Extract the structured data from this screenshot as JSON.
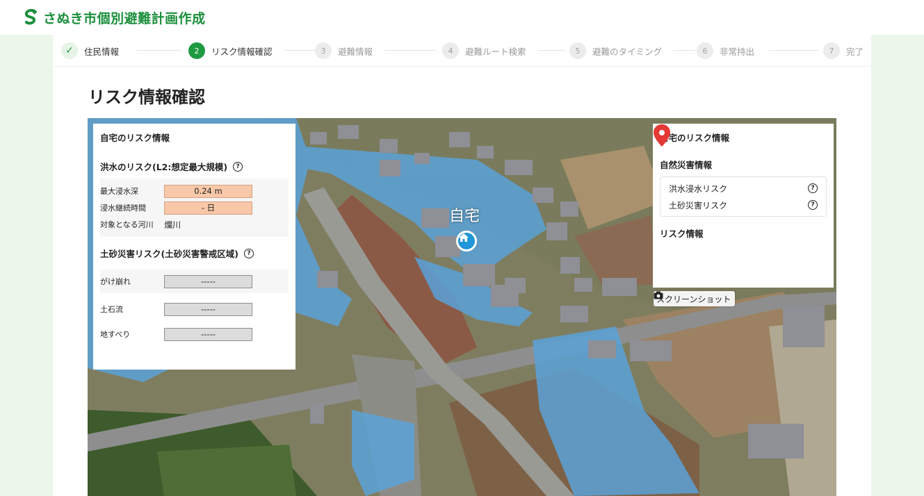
{
  "app": {
    "title": "さぬき市個別避難計画作成"
  },
  "steps": [
    {
      "num": "✓",
      "label": "住民情報",
      "state": "done"
    },
    {
      "num": "2",
      "label": "リスク情報確認",
      "state": "active"
    },
    {
      "num": "3",
      "label": "避難情報",
      "state": "pending"
    },
    {
      "num": "4",
      "label": "避難ルート検索",
      "state": "pending"
    },
    {
      "num": "5",
      "label": "避難のタイミング",
      "state": "pending"
    },
    {
      "num": "6",
      "label": "非常持出",
      "state": "pending"
    },
    {
      "num": "7",
      "label": "完了",
      "state": "pending"
    }
  ],
  "page": {
    "title": "リスク情報確認"
  },
  "map": {
    "home_label": "自宅"
  },
  "left_panel": {
    "title": "自宅のリスク情報",
    "flood": {
      "heading": "洪水のリスク(L2:想定最大規模)",
      "help": "?",
      "rows": [
        {
          "label": "最大浸水深",
          "value": "0.24 m"
        },
        {
          "label": "浸水継続時間",
          "value": "- 日"
        },
        {
          "label": "対象となる河川",
          "value": "爛川"
        }
      ]
    },
    "landslide": {
      "heading": "土砂災害リスク(土砂災害警戒区域)",
      "help": "?",
      "rows": [
        {
          "label": "がけ崩れ",
          "value": "-----"
        },
        {
          "label": "土石流",
          "value": "-----"
        },
        {
          "label": "地すべり",
          "value": "-----"
        }
      ]
    }
  },
  "right_panel": {
    "title": "自宅のリスク情報",
    "natural_heading": "自然災害情報",
    "layers": [
      {
        "label": "洪水浸水リスク",
        "help": "?"
      },
      {
        "label": "土砂災害リスク",
        "help": "?"
      }
    ],
    "risk_heading": "リスク情報"
  },
  "screenshot_button": {
    "label": "スクリーンショット"
  },
  "colors": {
    "brand": "#1b8f3b",
    "active_step": "#1e9a40",
    "flood_value_bg": "#f8c8a8",
    "flood_overlay": "#5aa2d8",
    "pin": "#e53935",
    "home_marker": "#2196d9"
  }
}
